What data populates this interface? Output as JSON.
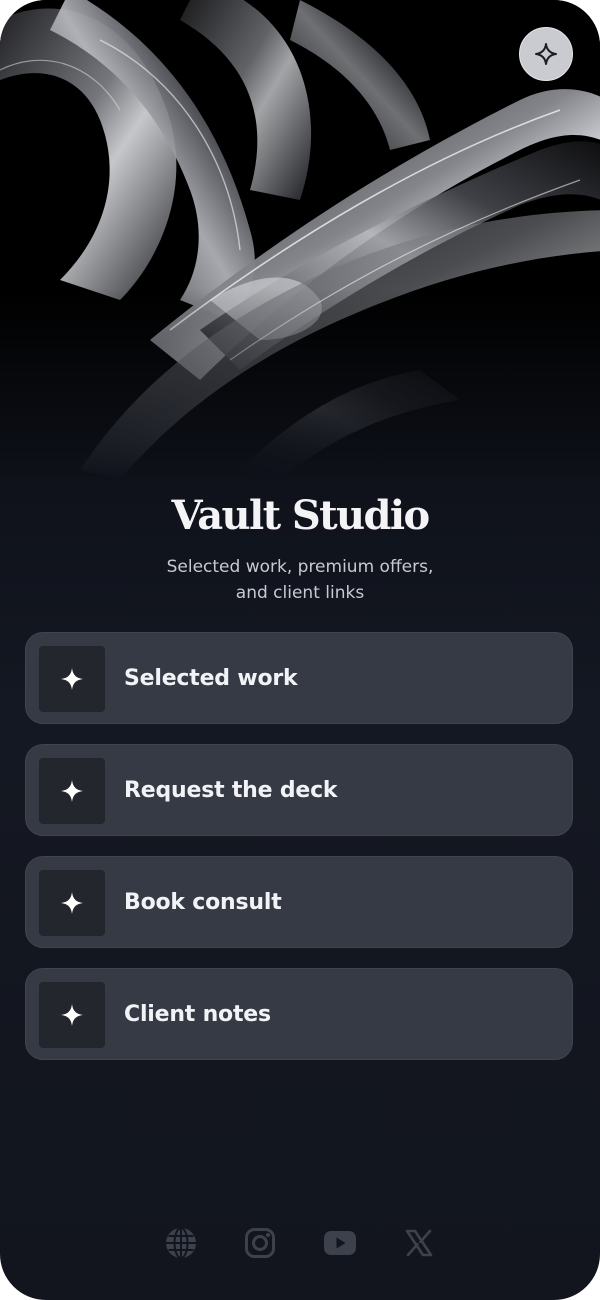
{
  "profile": {
    "title": "Vault Studio",
    "subtitle": "Selected work, premium offers, and client links"
  },
  "header": {
    "action_icon": "sparkle-icon"
  },
  "links": [
    {
      "label": "Selected work",
      "icon": "sparkle-icon"
    },
    {
      "label": "Request the deck",
      "icon": "sparkle-icon"
    },
    {
      "label": "Book consult",
      "icon": "sparkle-icon"
    },
    {
      "label": "Client notes",
      "icon": "sparkle-icon"
    }
  ],
  "socials": [
    "globe-icon",
    "instagram-icon",
    "youtube-icon",
    "x-icon"
  ],
  "colors": {
    "background": "#12151d",
    "card": "#353a45",
    "icon_tile": "#23262d",
    "text": "#f2f3f6",
    "muted_text": "#c7cad2",
    "social_icon": "#3c414c"
  }
}
